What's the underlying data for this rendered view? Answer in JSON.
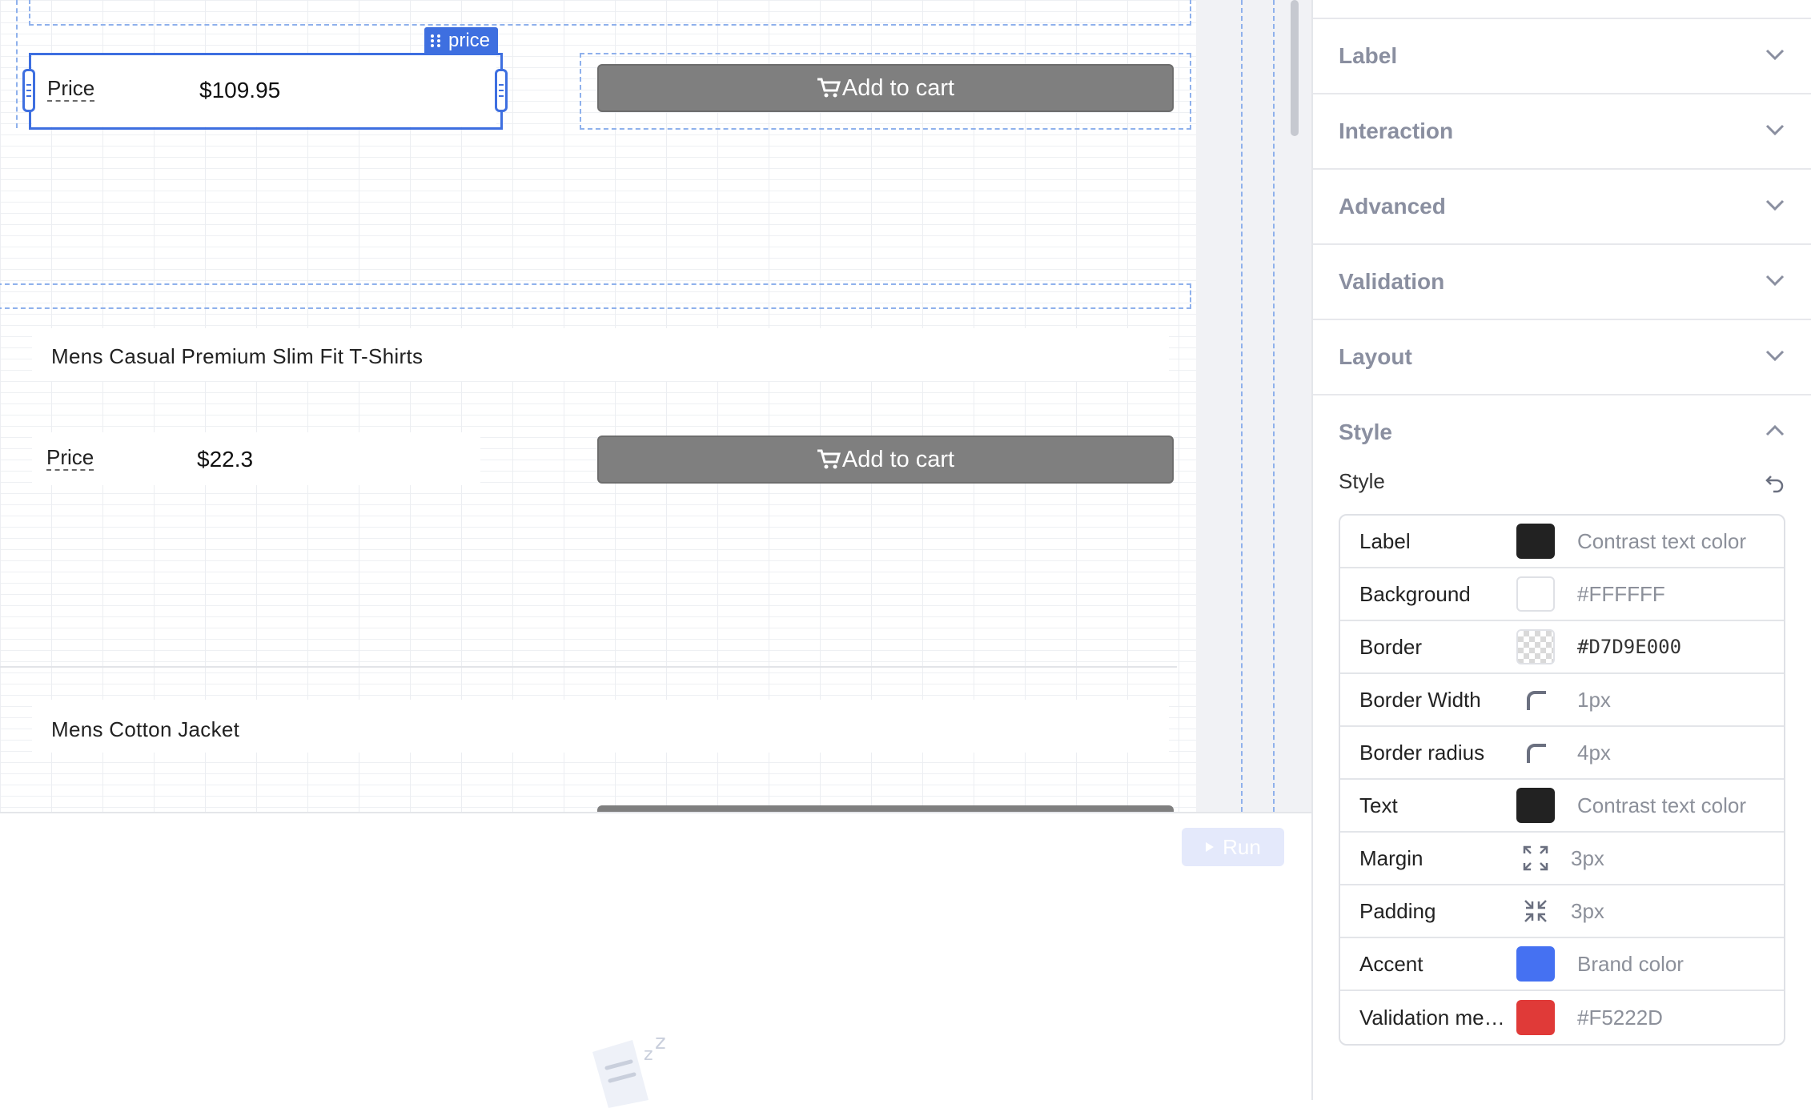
{
  "canvas": {
    "widget_tag": "price",
    "products": [
      {
        "title": "",
        "price_label": "Price",
        "price_value": "$109.95",
        "button_label": "Add to cart"
      },
      {
        "title": "Mens Casual Premium Slim Fit T-Shirts",
        "price_label": "Price",
        "price_value": "$22.3",
        "button_label": "Add to cart"
      },
      {
        "title": "Mens Cotton Jacket"
      }
    ]
  },
  "bottom": {
    "run_label": "Run"
  },
  "inspector": {
    "sections": [
      "Label",
      "Interaction",
      "Advanced",
      "Validation",
      "Layout"
    ],
    "style_section": "Style",
    "style_sub_label": "Style",
    "style_rows": [
      {
        "label": "Label",
        "value": "Contrast text color",
        "kind": "swatch",
        "color": "#222222"
      },
      {
        "label": "Background",
        "value": "#FFFFFF",
        "kind": "swatch",
        "color": "#FFFFFF"
      },
      {
        "label": "Border",
        "value": "#D7D9E000",
        "kind": "checker",
        "color": "#D7D9E000"
      },
      {
        "label": "Border Width",
        "value": "1px",
        "kind": "corner-icon"
      },
      {
        "label": "Border radius",
        "value": "4px",
        "kind": "corner-icon"
      },
      {
        "label": "Text",
        "value": "Contrast text color",
        "kind": "swatch",
        "color": "#222222"
      },
      {
        "label": "Margin",
        "value": "3px",
        "kind": "expand-icon"
      },
      {
        "label": "Padding",
        "value": "3px",
        "kind": "collapse-icon"
      },
      {
        "label": "Accent",
        "value": "Brand color",
        "kind": "swatch",
        "color": "#4571F2"
      },
      {
        "label": "Validation me…",
        "value": "#F5222D",
        "kind": "swatch",
        "color": "#E03A38"
      }
    ]
  },
  "colors": {
    "selection": "#3E6FE0",
    "button_gray": "#7F7F7F",
    "accent": "#4571F2",
    "danger": "#E03A38"
  }
}
